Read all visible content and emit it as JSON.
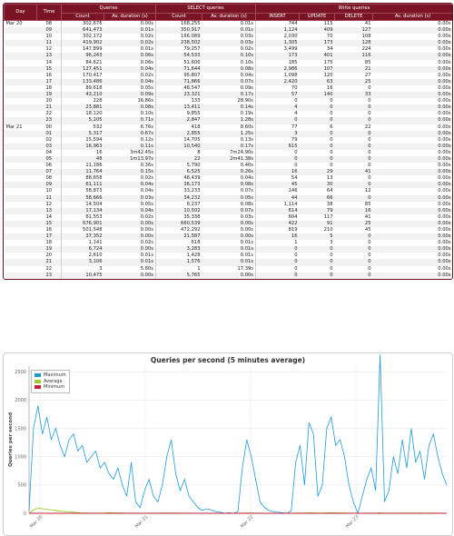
{
  "table": {
    "headers": {
      "day": "Day",
      "time": "Time",
      "queries": "Queries",
      "select_queries": "SELECT queries",
      "write_queries": "Write queries",
      "count": "Count",
      "av_duration": "Av. duration (s)",
      "insert": "INSERT",
      "update": "UPDATE",
      "delete": "DELETE"
    },
    "rows": [
      [
        "Mar 20",
        "08",
        "302,676",
        "0.00s",
        "168,255",
        "0.01s",
        "744",
        "115",
        "41",
        "0.00s"
      ],
      [
        "",
        "09",
        "641,473",
        "0.01s",
        "350,917",
        "0.01s",
        "1,124",
        "409",
        "127",
        "0.00s"
      ],
      [
        "",
        "10",
        "302,172",
        "0.02s",
        "166,089",
        "0.03s",
        "2,030",
        "70",
        "108",
        "0.00s"
      ],
      [
        "",
        "11",
        "419,902",
        "0.02s",
        "238,502",
        "0.03s",
        "1,305",
        "173",
        "128",
        "0.00s"
      ],
      [
        "",
        "12",
        "147,899",
        "0.01s",
        "79,257",
        "0.02s",
        "3,499",
        "34",
        "224",
        "0.00s"
      ],
      [
        "",
        "13",
        "96,243",
        "0.06s",
        "54,533",
        "0.10s",
        "173",
        "401",
        "116",
        "0.00s"
      ],
      [
        "",
        "14",
        "84,621",
        "0.06s",
        "51,606",
        "0.10s",
        "185",
        "175",
        "85",
        "0.00s"
      ],
      [
        "",
        "15",
        "127,451",
        "0.04s",
        "71,644",
        "0.08s",
        "2,986",
        "107",
        "21",
        "0.00s"
      ],
      [
        "",
        "16",
        "170,417",
        "0.02s",
        "95,807",
        "0.04s",
        "1,098",
        "120",
        "27",
        "0.00s"
      ],
      [
        "",
        "17",
        "133,486",
        "0.04s",
        "71,866",
        "0.07s",
        "2,420",
        "63",
        "25",
        "0.00s"
      ],
      [
        "",
        "18",
        "89,618",
        "0.05s",
        "48,547",
        "0.09s",
        "70",
        "16",
        "0",
        "0.00s"
      ],
      [
        "",
        "19",
        "43,210",
        "0.09s",
        "23,321",
        "0.17s",
        "57",
        "140",
        "33",
        "0.00s"
      ],
      [
        "",
        "20",
        "228",
        "16.86s",
        "133",
        "28.90s",
        "0",
        "0",
        "0",
        "0.00s"
      ],
      [
        "",
        "21",
        "23,881",
        "0.08s",
        "13,411",
        "0.14s",
        "4",
        "0",
        "0",
        "0.00s"
      ],
      [
        "",
        "22",
        "18,120",
        "0.10s",
        "9,855",
        "0.19s",
        "4",
        "0",
        "0",
        "0.00s"
      ],
      [
        "",
        "23",
        "5,105",
        "0.71s",
        "2,847",
        "1.28s",
        "0",
        "0",
        "0",
        "0.00s"
      ],
      [
        "Mar 21",
        "00",
        "532",
        "6.76s",
        "418",
        "8.60s",
        "77",
        "6",
        "22",
        "0.00s"
      ],
      [
        "",
        "01",
        "5,317",
        "0.67s",
        "2,855",
        "1.25s",
        "3",
        "0",
        "0",
        "0.00s"
      ],
      [
        "",
        "02",
        "15,594",
        "0.12s",
        "14,705",
        "0.13s",
        "79",
        "0",
        "0",
        "0.00s"
      ],
      [
        "",
        "03",
        "16,963",
        "0.11s",
        "10,540",
        "0.17s",
        "615",
        "0",
        "0",
        "0.00s"
      ],
      [
        "",
        "04",
        "16",
        "3m42.45s",
        "8",
        "7m24.90s",
        "0",
        "0",
        "0",
        "0.00s"
      ],
      [
        "",
        "05",
        "48",
        "1m13.97s",
        "22",
        "2m41.38s",
        "0",
        "0",
        "0",
        "0.00s"
      ],
      [
        "",
        "06",
        "11,186",
        "0.36s",
        "5,790",
        "0.40s",
        "0",
        "0",
        "0",
        "0.00s"
      ],
      [
        "",
        "07",
        "11,764",
        "0.15s",
        "6,525",
        "0.26s",
        "16",
        "29",
        "41",
        "0.00s"
      ],
      [
        "",
        "08",
        "88,658",
        "0.02s",
        "48,439",
        "0.04s",
        "54",
        "13",
        "0",
        "0.00s"
      ],
      [
        "",
        "09",
        "61,111",
        "0.04s",
        "36,173",
        "0.08s",
        "45",
        "30",
        "0",
        "0.00s"
      ],
      [
        "",
        "10",
        "58,873",
        "0.04s",
        "33,233",
        "0.07s",
        "146",
        "64",
        "12",
        "0.00s"
      ],
      [
        "",
        "11",
        "58,666",
        "0.03s",
        "34,232",
        "0.05s",
        "44",
        "66",
        "0",
        "0.00s"
      ],
      [
        "",
        "12",
        "14,504",
        "0.05s",
        "8,237",
        "0.08s",
        "1,114",
        "38",
        "85",
        "0.00s"
      ],
      [
        "",
        "13",
        "17,134",
        "0.04s",
        "10,502",
        "0.07s",
        "614",
        "79",
        "16",
        "0.00s"
      ],
      [
        "",
        "14",
        "61,553",
        "0.02s",
        "35,338",
        "0.03s",
        "604",
        "117",
        "41",
        "0.00s"
      ],
      [
        "",
        "15",
        "676,901",
        "0.00s",
        "660,539",
        "0.00s",
        "422",
        "91",
        "25",
        "0.00s"
      ],
      [
        "",
        "16",
        "501,548",
        "0.00s",
        "472,292",
        "0.00s",
        "819",
        "210",
        "45",
        "0.00s"
      ],
      [
        "",
        "17",
        "37,352",
        "0.00s",
        "21,587",
        "0.00s",
        "16",
        "5",
        "0",
        "0.00s"
      ],
      [
        "",
        "18",
        "1,141",
        "0.02s",
        "618",
        "0.01s",
        "1",
        "3",
        "0",
        "0.00s"
      ],
      [
        "",
        "19",
        "6,724",
        "0.00s",
        "3,283",
        "0.01s",
        "0",
        "0",
        "0",
        "0.00s"
      ],
      [
        "",
        "20",
        "2,610",
        "0.01s",
        "1,428",
        "0.01s",
        "0",
        "0",
        "0",
        "0.00s"
      ],
      [
        "",
        "21",
        "3,106",
        "0.01s",
        "1,576",
        "0.01s",
        "0",
        "0",
        "0",
        "0.00s"
      ],
      [
        "",
        "22",
        "3",
        "5.80s",
        "1",
        "17.39s",
        "0",
        "0",
        "0",
        "0.00s"
      ],
      [
        "",
        "23",
        "10,475",
        "0.00s",
        "5,765",
        "0.00s",
        "0",
        "0",
        "0",
        "0.00s"
      ]
    ]
  },
  "chart_data": {
    "type": "line",
    "title": "Queries per second (5 minutes average)",
    "ylabel": "Queries per second",
    "xlabel": "",
    "ylim": [
      0,
      2600
    ],
    "yticks": [
      "0",
      "500",
      "1000",
      "1500",
      "2000",
      "2500"
    ],
    "xticks": [
      "Mar 20",
      "Mar 21",
      "Mar 22",
      "Mar 23"
    ],
    "legend": "top-left",
    "series": [
      {
        "name": "Maximum",
        "color": "#1e9ad6",
        "values": [
          40,
          1500,
          1900,
          1400,
          1700,
          1300,
          1500,
          1200,
          1000,
          1300,
          1400,
          1100,
          1200,
          900,
          1000,
          1100,
          800,
          900,
          700,
          600,
          800,
          500,
          300,
          900,
          200,
          100,
          400,
          600,
          300,
          200,
          500,
          1000,
          1300,
          700,
          400,
          600,
          300,
          200,
          100,
          50,
          80,
          60,
          30,
          20,
          0,
          10,
          0,
          30,
          800,
          1300,
          1000,
          600,
          200,
          100,
          50,
          30,
          20,
          10,
          0,
          40,
          900,
          1200,
          500,
          1600,
          1400,
          300,
          500,
          1500,
          1700,
          1200,
          1300,
          1000,
          500,
          200,
          0,
          300,
          600,
          800,
          400,
          2800,
          200,
          400,
          1000,
          700,
          1300,
          800,
          1500,
          900,
          1100,
          600,
          1200,
          1400,
          1000,
          700,
          500
        ]
      },
      {
        "name": "Average",
        "color": "#9acd32",
        "values": [
          0,
          60,
          90,
          80,
          70,
          60,
          50,
          40,
          30,
          25,
          20,
          10,
          5,
          5,
          3,
          2,
          2,
          5,
          10,
          8,
          6,
          4,
          3,
          2,
          2,
          1,
          1,
          2,
          3,
          2,
          4,
          6,
          5,
          4,
          3,
          2,
          2,
          1,
          1,
          0,
          0,
          0,
          0,
          0,
          0,
          0,
          0,
          0,
          3,
          5,
          4,
          3,
          2,
          1,
          1,
          0,
          0,
          0,
          0,
          0,
          3,
          5,
          3,
          8,
          6,
          2,
          3,
          7,
          8,
          6,
          5,
          4,
          2,
          1,
          0,
          1,
          2,
          3,
          2,
          8,
          1,
          2,
          3,
          2,
          4,
          3,
          5,
          3,
          4,
          2,
          3,
          4,
          3,
          2,
          1
        ]
      },
      {
        "name": "Minimum",
        "color": "#c0203a",
        "values": [
          0,
          0,
          0,
          0,
          0,
          0,
          0,
          0,
          0,
          0,
          0,
          0,
          0,
          0,
          0,
          0,
          0,
          0,
          0,
          0,
          0,
          0,
          0,
          0,
          0,
          0,
          0,
          0,
          0,
          0,
          0,
          0,
          0,
          0,
          0,
          0,
          0,
          0,
          0,
          0,
          0,
          0,
          0,
          0,
          0,
          0,
          0,
          0,
          0,
          0,
          0,
          0,
          0,
          0,
          0,
          0,
          0,
          0,
          0,
          0,
          0,
          0,
          0,
          0,
          0,
          0,
          0,
          0,
          0,
          0,
          0,
          0,
          0,
          0,
          0,
          0,
          0,
          0,
          0,
          0,
          0,
          0,
          0,
          0,
          0,
          0,
          0,
          0,
          0,
          0,
          0,
          0,
          0,
          0,
          0
        ]
      }
    ]
  }
}
